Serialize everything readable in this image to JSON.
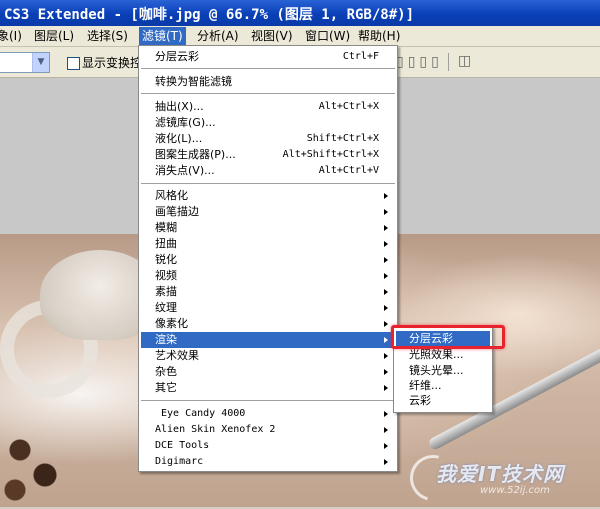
{
  "window": {
    "title": "CS3 Extended - [咖啡.jpg @ 66.7% (图层 1, RGB/8#)]"
  },
  "menubar": [
    {
      "label": "象(I)"
    },
    {
      "label": "图层(L)"
    },
    {
      "label": "选择(S)"
    },
    {
      "label": "滤镜(T)"
    },
    {
      "label": "分析(A)"
    },
    {
      "label": "视图(V)"
    },
    {
      "label": "窗口(W)"
    },
    {
      "label": "帮助(H)"
    }
  ],
  "options_bar": {
    "checkbox_label": "显示变换控"
  },
  "filter_menu": {
    "items": [
      {
        "label": "分层云彩",
        "shortcut": "Ctrl+F"
      },
      {
        "label": "转换为智能滤镜",
        "shortcut": ""
      },
      {
        "label": "抽出(X)...",
        "shortcut": "Alt+Ctrl+X"
      },
      {
        "label": "滤镜库(G)...",
        "shortcut": ""
      },
      {
        "label": "液化(L)...",
        "shortcut": "Shift+Ctrl+X"
      },
      {
        "label": "图案生成器(P)...",
        "shortcut": "Alt+Shift+Ctrl+X"
      },
      {
        "label": "消失点(V)...",
        "shortcut": "Alt+Ctrl+V"
      },
      {
        "label": "风格化"
      },
      {
        "label": "画笔描边"
      },
      {
        "label": "模糊"
      },
      {
        "label": "扭曲"
      },
      {
        "label": "锐化"
      },
      {
        "label": "视频"
      },
      {
        "label": "素描"
      },
      {
        "label": "纹理"
      },
      {
        "label": "像素化"
      },
      {
        "label": "渲染"
      },
      {
        "label": "艺术效果"
      },
      {
        "label": "杂色"
      },
      {
        "label": "其它"
      },
      {
        "label": "Eye Candy 4000"
      },
      {
        "label": "Alien Skin Xenofex 2"
      },
      {
        "label": "DCE Tools"
      },
      {
        "label": "Digimarc"
      }
    ]
  },
  "render_submenu": {
    "items": [
      {
        "label": "分层云彩"
      },
      {
        "label": "光照效果..."
      },
      {
        "label": "镜头光晕..."
      },
      {
        "label": "纤维..."
      },
      {
        "label": "云彩"
      }
    ]
  },
  "watermark": {
    "text": "我爱IT技术网",
    "sub": "www.52ij.com"
  },
  "colors": {
    "highlight": "#316ac5",
    "annotation": "#e8232d",
    "titlebar": "#0a3fb7"
  }
}
